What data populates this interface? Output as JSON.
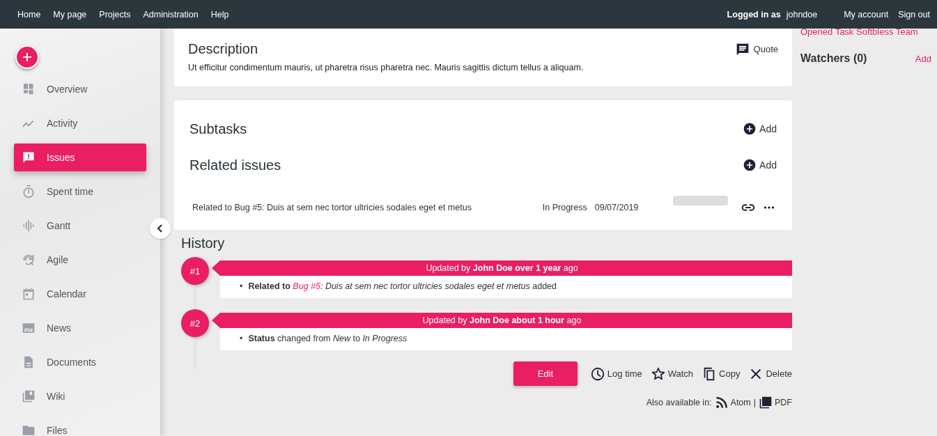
{
  "top_menu": {
    "left": [
      "Home",
      "My page",
      "Projects",
      "Administration",
      "Help"
    ],
    "logged_in_label": "Logged in as",
    "user": "johndoe",
    "right": [
      "My account",
      "Sign out"
    ]
  },
  "sidebar": {
    "items": [
      {
        "label": "Overview",
        "selected": false
      },
      {
        "label": "Activity",
        "selected": false
      },
      {
        "label": "Issues",
        "selected": true
      },
      {
        "label": "Spent time",
        "selected": false
      },
      {
        "label": "Gantt",
        "selected": false
      },
      {
        "label": "Agile",
        "selected": false
      },
      {
        "label": "Calendar",
        "selected": false
      },
      {
        "label": "News",
        "selected": false
      },
      {
        "label": "Documents",
        "selected": false
      },
      {
        "label": "Wiki",
        "selected": false
      },
      {
        "label": "Files",
        "selected": false
      }
    ]
  },
  "description": {
    "title": "Description",
    "quote": "Quote",
    "text": "Ut efficitur condimentum mauris, ut pharetra risus pharetra nec. Mauris sagittis dictum tellus a aliquam."
  },
  "subtasks": {
    "title": "Subtasks",
    "add": "Add"
  },
  "related_issues": {
    "title": "Related issues",
    "add": "Add",
    "rows": [
      {
        "subject": "Related to Bug #5: Duis at sem nec tortor ultricies sodales eget et metus",
        "status": "In Progress",
        "date": "09/07/2019",
        "level": 0
      }
    ]
  },
  "history": {
    "title": "History",
    "entries": [
      {
        "number": "#1",
        "header": "Updated by **John Doe over 1 year** ago",
        "details": [
          {
            "bullet": "•",
            "field": "Related to",
            "link": "Bug #5",
            "text": "*: Duis at sem nec tortor ultricies sodales eget et metus* added"
          }
        ]
      },
      {
        "number": "#2",
        "header": "Updated by **John Doe about 1 hour** ago",
        "details": [
          {
            "bullet": "•",
            "field": "Status",
            "text": "changed from *New* to *In Progress*"
          }
        ]
      }
    ]
  },
  "actions": {
    "edit": "Edit",
    "others": [
      "Log time",
      "Watch",
      "Copy",
      "Delete"
    ]
  },
  "formats": {
    "label": "Also available in:",
    "items": [
      "Atom",
      "PDF"
    ],
    "separator": "|"
  },
  "right_panel": {
    "link": "Opened Task Softbless Team",
    "watchers": "Watchers (0)",
    "add": "Add"
  }
}
